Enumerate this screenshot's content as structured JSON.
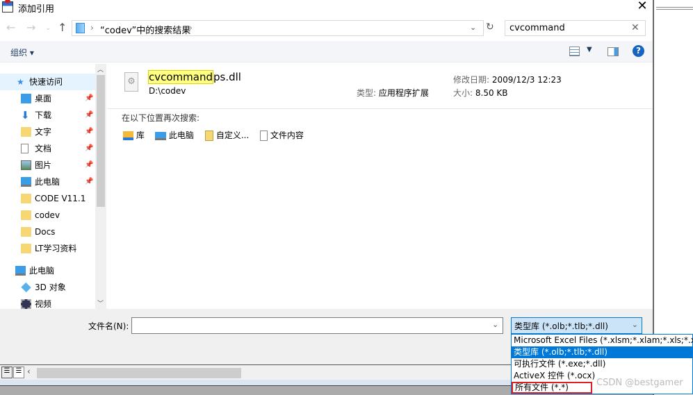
{
  "window": {
    "title": "添加引用"
  },
  "address": {
    "path": "“codev”中的搜索结果"
  },
  "search": {
    "value": "cvcommand"
  },
  "toolbar": {
    "organize": "组织 ▾"
  },
  "sidebar": {
    "items": [
      {
        "label": "快速访问",
        "icon": "star-icon",
        "pin": false
      },
      {
        "label": "桌面",
        "icon": "desktop-icon",
        "pin": true
      },
      {
        "label": "下载",
        "icon": "download-icon",
        "pin": true
      },
      {
        "label": "文字",
        "icon": "folder-icon",
        "pin": true
      },
      {
        "label": "文档",
        "icon": "document-icon",
        "pin": true
      },
      {
        "label": "图片",
        "icon": "picture-icon",
        "pin": true
      },
      {
        "label": "此电脑",
        "icon": "computer-icon",
        "pin": true
      },
      {
        "label": "CODE V11.1",
        "icon": "folder-icon",
        "pin": false
      },
      {
        "label": "codev",
        "icon": "folder-icon",
        "pin": false
      },
      {
        "label": "Docs",
        "icon": "folder-icon",
        "pin": false
      },
      {
        "label": "LT学习资料",
        "icon": "folder-icon",
        "pin": false
      },
      {
        "label": "此电脑",
        "icon": "computer-icon",
        "pin": false
      },
      {
        "label": "3D 对象",
        "icon": "cube-icon",
        "pin": false
      },
      {
        "label": "视频",
        "icon": "video-icon",
        "pin": false
      }
    ]
  },
  "result": {
    "name_match": "cvcommand",
    "name_rest": "ps.dll",
    "location": "D:\\codev",
    "type_label": "类型:",
    "type_value": "应用程序扩展",
    "modified_label": "修改日期:",
    "modified_value": "2009/12/3 12:23",
    "size_label": "大小:",
    "size_value": "8.50 KB"
  },
  "search_again": {
    "label": "在以下位置再次搜索:",
    "items": [
      "库",
      "此电脑",
      "自定义...",
      "文件内容"
    ]
  },
  "bottom": {
    "filename_label": "文件名(N):",
    "filename_value": "",
    "filetype_selected": "类型库 (*.olb;*.tlb;*.dll)",
    "filetype_options": [
      "Microsoft Excel Files (*.xlsm;*.xlam;*.xls;*.xla)",
      "类型库 (*.olb;*.tlb;*.dll)",
      "可执行文件 (*.exe;*.dll)",
      "ActiveX 控件 (*.ocx)",
      "所有文件 (*.*)"
    ]
  },
  "watermark": "CSDN @bestgamer",
  "colors": {
    "accent": "#0078d7",
    "highlight": "#ffff80",
    "annotation": "#e02020"
  }
}
